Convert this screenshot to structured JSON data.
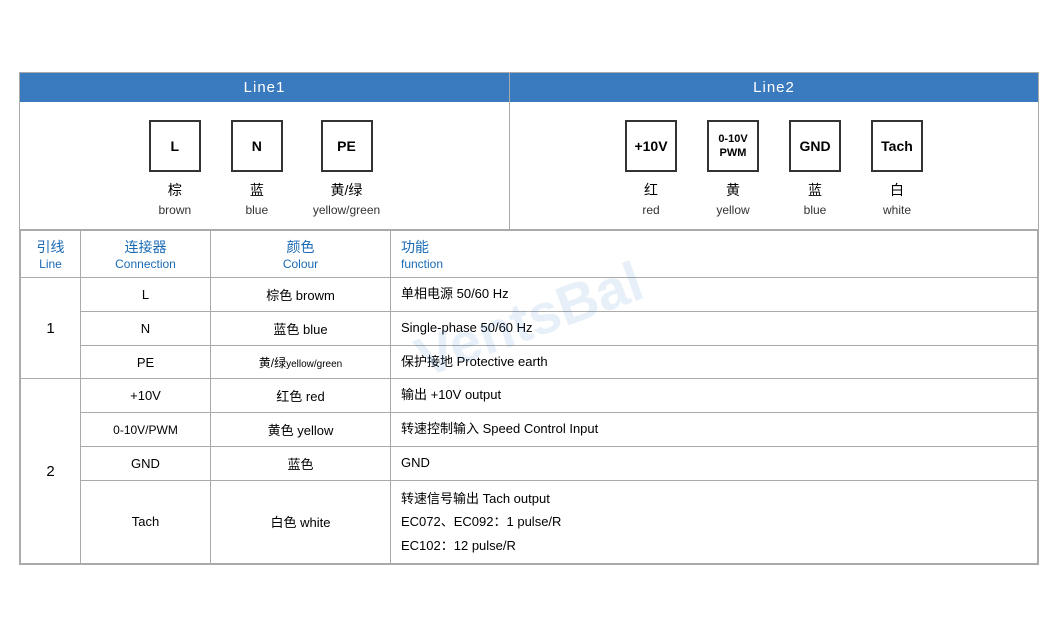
{
  "header": {
    "line1_label": "Line1",
    "line2_label": "Line2"
  },
  "line1_connectors": [
    {
      "symbol": "L",
      "cn": "棕",
      "en": "brown"
    },
    {
      "symbol": "N",
      "cn": "蓝",
      "en": "blue"
    },
    {
      "symbol": "PE",
      "cn": "黄/绿",
      "en": "yellow/green"
    }
  ],
  "line2_connectors": [
    {
      "symbol": "+10V",
      "cn": "红",
      "en": "red"
    },
    {
      "symbol": "0-10V\nPWM",
      "cn": "黄",
      "en": "yellow"
    },
    {
      "symbol": "GND",
      "cn": "蓝",
      "en": "blue"
    },
    {
      "symbol": "Tach",
      "cn": "白",
      "en": "white"
    }
  ],
  "table": {
    "headers": {
      "line_cn": "引线",
      "line_en": "Line",
      "conn_cn": "连接器",
      "conn_en": "Connection",
      "colour_cn": "颜色",
      "colour_en": "Colour",
      "func_cn": "功能",
      "func_en": "function"
    },
    "rows": [
      {
        "line": "1",
        "entries": [
          {
            "conn": "L",
            "colour_cn": "棕色",
            "colour_en": "browm",
            "func": "单相电源 50/60 Hz"
          },
          {
            "conn": "N",
            "colour_cn": "蓝色",
            "colour_en": "blue",
            "func": "Single-phase 50/60 Hz"
          },
          {
            "conn": "PE",
            "colour_cn": "黄/绿",
            "colour_en": "yellow/green",
            "func": "保护接地 Protective earth"
          }
        ]
      },
      {
        "line": "2",
        "entries": [
          {
            "conn": "+10V",
            "colour_cn": "红色",
            "colour_en": "red",
            "func": "输出 +10V output"
          },
          {
            "conn": "0-10V/PWM",
            "colour_cn": "黄色",
            "colour_en": "yellow",
            "func": "转速控制输入 Speed Control Input"
          },
          {
            "conn": "GND",
            "colour_cn": "蓝色",
            "colour_en": "",
            "func": "GND"
          },
          {
            "conn": "Tach",
            "colour_cn": "白色",
            "colour_en": "white",
            "func": "转速信号输出 Tach output\nEC072、EC092：1 pulse/R\nEC102：12 pulse/R"
          }
        ]
      }
    ]
  }
}
